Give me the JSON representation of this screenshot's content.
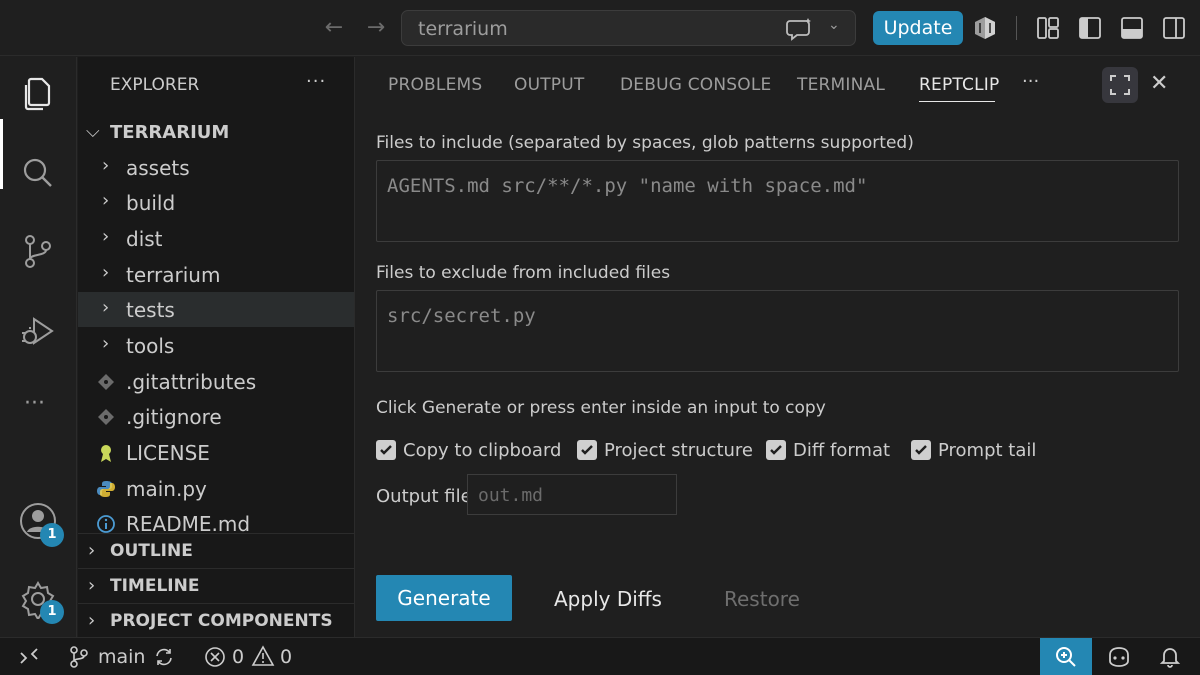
{
  "titlebar": {
    "search_text": "terrarium",
    "update_label": "Update",
    "icons": [
      "arrow-left-icon",
      "arrow-right-icon",
      "copilot-chat-icon",
      "chevron-down-icon",
      "accounts-shield-icon",
      "customize-layout-icon",
      "toggle-primary-sidebar-icon",
      "toggle-panel-icon",
      "toggle-secondary-sidebar-icon"
    ]
  },
  "activity": {
    "accounts_badge": "1",
    "settings_badge": "1",
    "more": "···"
  },
  "sidebar": {
    "header": "EXPLORER",
    "more": "···",
    "root": "TERRARIUM",
    "items": [
      {
        "label": "assets",
        "type": "folder"
      },
      {
        "label": "build",
        "type": "folder"
      },
      {
        "label": "dist",
        "type": "folder"
      },
      {
        "label": "terrarium",
        "type": "folder"
      },
      {
        "label": "tests",
        "type": "folder"
      },
      {
        "label": "tools",
        "type": "folder"
      },
      {
        "label": ".gitattributes",
        "type": "git"
      },
      {
        "label": ".gitignore",
        "type": "git"
      },
      {
        "label": "LICENSE",
        "type": "license"
      },
      {
        "label": "main.py",
        "type": "python"
      },
      {
        "label": "README.md",
        "type": "info"
      }
    ],
    "sections": [
      "OUTLINE",
      "TIMELINE",
      "PROJECT COMPONENTS"
    ]
  },
  "panel": {
    "tabs": [
      "PROBLEMS",
      "OUTPUT",
      "DEBUG CONSOLE",
      "TERMINAL",
      "REPTCLIP"
    ],
    "active_tab": "REPTCLIP",
    "more": "···",
    "include_label": "Files to include (separated by spaces, glob patterns supported)",
    "include_placeholder": "AGENTS.md src/**/*.py \"name with space.md\"",
    "exclude_label": "Files to exclude from included files",
    "exclude_placeholder": "src/secret.py",
    "hint": "Click Generate or press enter inside an input to copy",
    "checkboxes": [
      {
        "label": "Copy to clipboard",
        "checked": true
      },
      {
        "label": "Project structure",
        "checked": true
      },
      {
        "label": "Diff format",
        "checked": true
      },
      {
        "label": "Prompt tail",
        "checked": true
      }
    ],
    "output_label": "Output file",
    "output_placeholder": "out.md",
    "generate_label": "Generate",
    "apply_label": "Apply Diffs",
    "restore_label": "Restore"
  },
  "statusbar": {
    "branch": "main",
    "errors": "0",
    "warnings": "0"
  },
  "colors": {
    "accent": "#2487b3",
    "background": "#1f1f1f",
    "sidebar": "#181818"
  }
}
